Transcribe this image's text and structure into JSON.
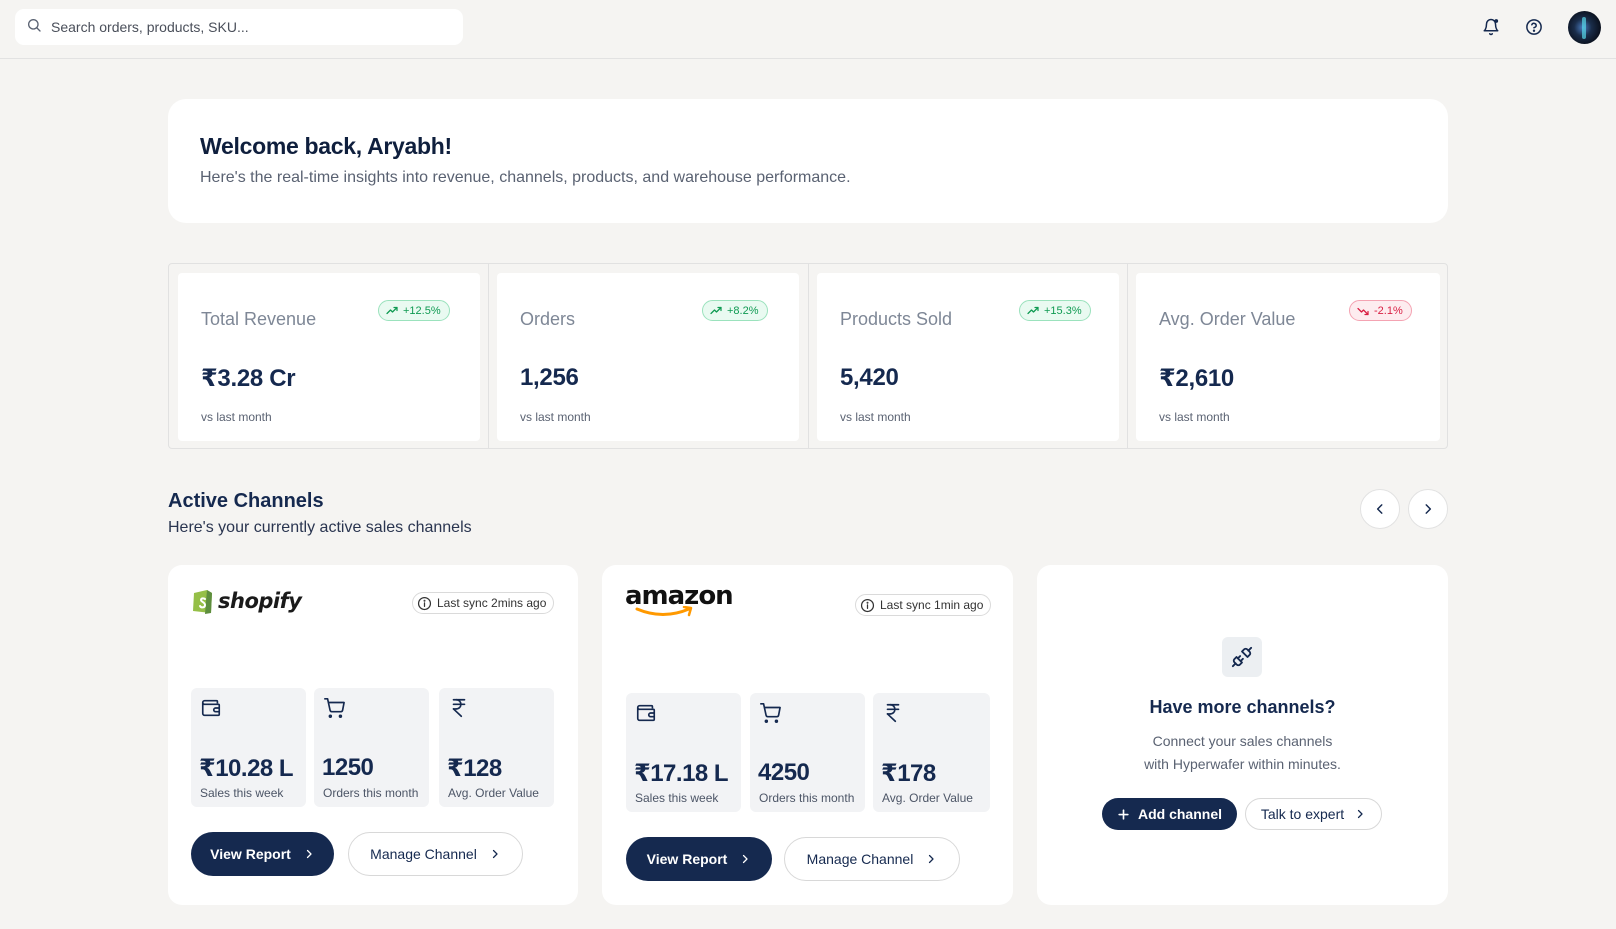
{
  "search": {
    "placeholder": "Search orders, products, SKU..."
  },
  "header": {
    "icons": [
      "bell-icon",
      "help-icon"
    ],
    "avatar": "user-avatar"
  },
  "welcome": {
    "title": "Welcome back, Aryabh!",
    "subtitle": "Here's the real-time insights into revenue, channels, products, and warehouse performance."
  },
  "stats": [
    {
      "label": "Total Revenue",
      "change": "+12.5%",
      "trend": "up",
      "value": "₹3.28 Cr",
      "sub": "vs last month"
    },
    {
      "label": "Orders",
      "change": "+8.2%",
      "trend": "up",
      "value": "1,256",
      "sub": "vs last month"
    },
    {
      "label": "Products Sold",
      "change": "+15.3%",
      "trend": "up",
      "value": "5,420",
      "sub": "vs last month"
    },
    {
      "label": "Avg. Order Value",
      "change": "-2.1%",
      "trend": "down",
      "value": "₹2,610",
      "sub": "vs last month"
    }
  ],
  "channels_section": {
    "title": "Active Channels",
    "subtitle": "Here's your currently active sales channels"
  },
  "channels": [
    {
      "name": "shopify",
      "sync": "Last sync 2mins ago",
      "metrics": [
        {
          "icon": "wallet-icon",
          "value": "₹10.28 L",
          "label": "Sales this week"
        },
        {
          "icon": "cart-icon",
          "value": "1250",
          "label": "Orders this month"
        },
        {
          "icon": "rupee-icon",
          "value": "₹128",
          "label": "Avg. Order Value"
        }
      ],
      "view_report": "View Report",
      "manage": "Manage Channel"
    },
    {
      "name": "amazon",
      "sync": "Last sync 1min ago",
      "metrics": [
        {
          "icon": "wallet-icon",
          "value": "₹17.18 L",
          "label": "Sales this week"
        },
        {
          "icon": "cart-icon",
          "value": "4250",
          "label": "Orders this month"
        },
        {
          "icon": "rupee-icon",
          "value": "₹178",
          "label": "Avg. Order Value"
        }
      ],
      "view_report": "View Report",
      "manage": "Manage Channel"
    }
  ],
  "add_channel": {
    "title": "Have more channels?",
    "line1": "Connect your sales channels",
    "line2": "with Hyperwafer within minutes.",
    "add_label": "Add channel",
    "expert_label": "Talk to expert"
  },
  "colors": {
    "primary": "#15294f",
    "positive": "#0f9a52",
    "negative": "#d81e42",
    "background": "#f5f4f2"
  }
}
